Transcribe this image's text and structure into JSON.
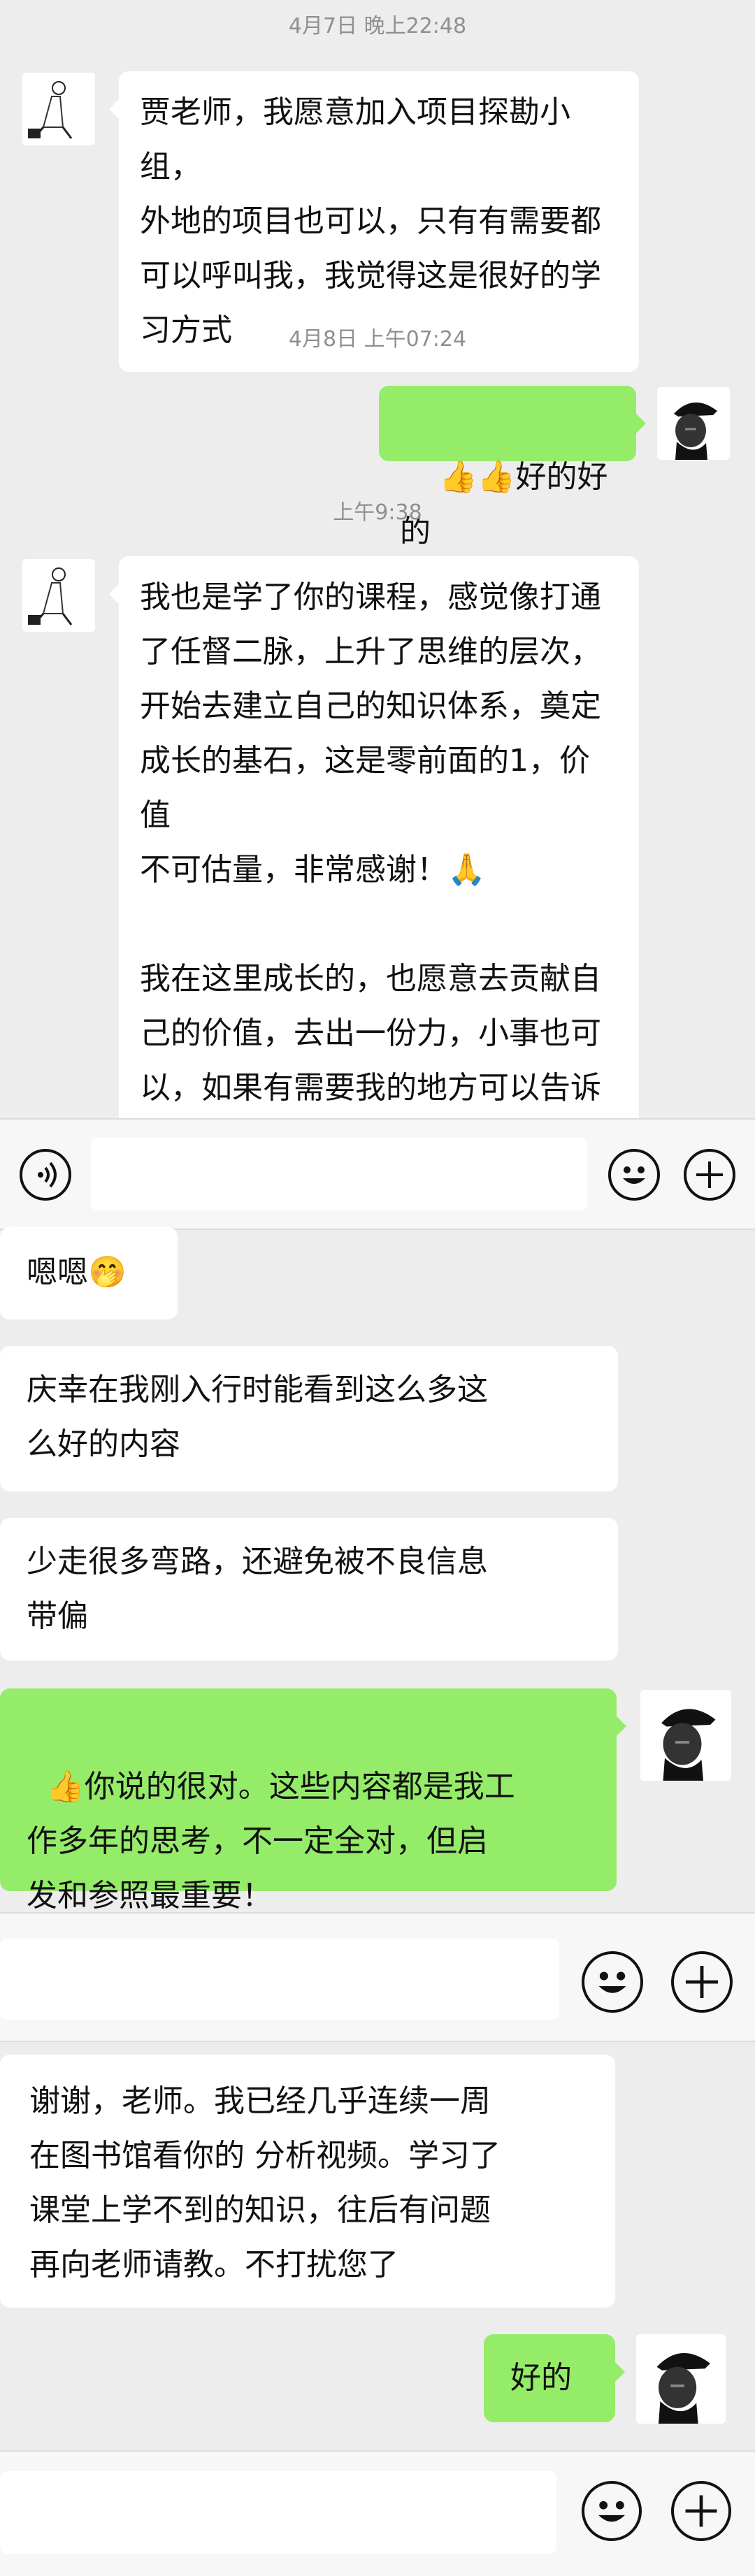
{
  "segment1": {
    "timestamps": [
      "4月7日 晚上22:48",
      "4月8日 上午07:24",
      "上午9:38"
    ],
    "messages": [
      {
        "side": "left",
        "text": "贾老师，我愿意加入项目探勘小组，\n外地的项目也可以，只有有需要都\n可以呼叫我，我觉得这是很好的学\n习方式"
      },
      {
        "side": "right",
        "emoji": "👍👍",
        "text": "好的好的"
      },
      {
        "side": "left",
        "text": "我也是学了你的课程，感觉像打通\n了任督二脉，上升了思维的层次，\n开始去建立自己的知识体系，奠定\n成长的基石，这是零前面的1，价值\n不可估量，非常感谢！🙏\n\n我在这里成长的，也愿意去贡献自\n己的价值，去出一份力，小事也可\n以，如果有需要我的地方可以告诉\n我呀！\n我非常乐意👌"
      }
    ]
  },
  "segment2": {
    "messages": [
      {
        "side": "left",
        "text": "嗯嗯🤭"
      },
      {
        "side": "left",
        "text": "庆幸在我刚入行时能看到这么多这\n么好的内容"
      },
      {
        "side": "left",
        "text": "少走很多弯路，还避免被不良信息\n带偏"
      },
      {
        "side": "right",
        "emoji": "👍",
        "text": "你说的很对。这些内容都是我工\n作多年的思考，不一定全对，但启\n发和参照最重要！"
      }
    ]
  },
  "segment3": {
    "messages": [
      {
        "side": "left",
        "text": "谢谢，老师。我已经几乎连续一周\n在图书馆看你的 分析视频。学习了\n课堂上学不到的知识，往后有问题\n再向老师请教。不打扰您了"
      },
      {
        "side": "right",
        "text": "好的"
      }
    ]
  },
  "icons": {
    "voice": "voice-icon",
    "emoji": "emoji-icon",
    "plus": "plus-icon"
  },
  "colors": {
    "background": "#ededed",
    "green_bubble": "#95ec69",
    "white_bubble": "#ffffff",
    "timestamp": "#8f8f8f",
    "input_bar": "#f7f7f7"
  }
}
